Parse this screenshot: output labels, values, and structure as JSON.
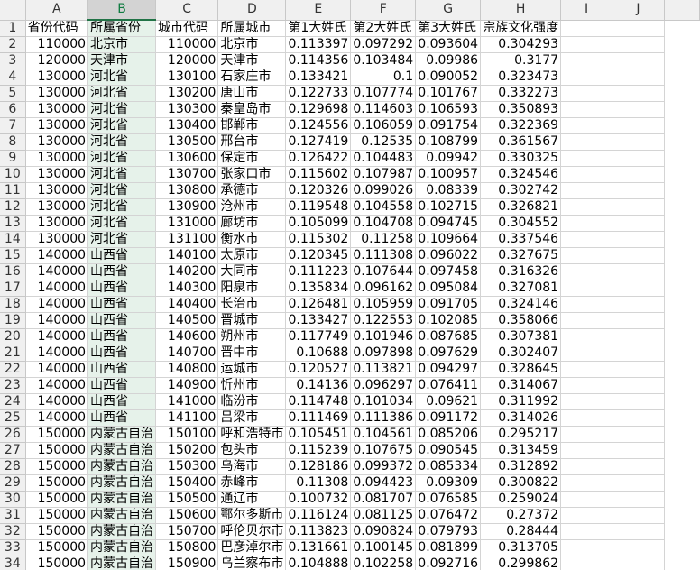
{
  "columns": [
    "A",
    "B",
    "C",
    "D",
    "E",
    "F",
    "G",
    "H",
    "I",
    "J"
  ],
  "selected_column": "B",
  "rows": [
    [
      "1",
      "省份代码",
      "所属省份",
      "城市代码",
      "所属城市",
      "第1大姓氏",
      "第2大姓氏",
      "第3大姓氏",
      "宗族文化强度",
      "",
      ""
    ],
    [
      "2",
      "110000",
      "北京市",
      "110000",
      "北京市",
      "0.113397",
      "0.097292",
      "0.093604",
      "0.304293",
      "",
      ""
    ],
    [
      "3",
      "120000",
      "天津市",
      "120000",
      "天津市",
      "0.114356",
      "0.103484",
      "0.09986",
      "0.3177",
      "",
      ""
    ],
    [
      "4",
      "130000",
      "河北省",
      "130100",
      "石家庄市",
      "0.133421",
      "0.1",
      "0.090052",
      "0.323473",
      "",
      ""
    ],
    [
      "5",
      "130000",
      "河北省",
      "130200",
      "唐山市",
      "0.122733",
      "0.107774",
      "0.101767",
      "0.332273",
      "",
      ""
    ],
    [
      "6",
      "130000",
      "河北省",
      "130300",
      "秦皇岛市",
      "0.129698",
      "0.114603",
      "0.106593",
      "0.350893",
      "",
      ""
    ],
    [
      "7",
      "130000",
      "河北省",
      "130400",
      "邯郸市",
      "0.124556",
      "0.106059",
      "0.091754",
      "0.322369",
      "",
      ""
    ],
    [
      "8",
      "130000",
      "河北省",
      "130500",
      "邢台市",
      "0.127419",
      "0.12535",
      "0.108799",
      "0.361567",
      "",
      ""
    ],
    [
      "9",
      "130000",
      "河北省",
      "130600",
      "保定市",
      "0.126422",
      "0.104483",
      "0.09942",
      "0.330325",
      "",
      ""
    ],
    [
      "10",
      "130000",
      "河北省",
      "130700",
      "张家口市",
      "0.115602",
      "0.107987",
      "0.100957",
      "0.324546",
      "",
      ""
    ],
    [
      "11",
      "130000",
      "河北省",
      "130800",
      "承德市",
      "0.120326",
      "0.099026",
      "0.08339",
      "0.302742",
      "",
      ""
    ],
    [
      "12",
      "130000",
      "河北省",
      "130900",
      "沧州市",
      "0.119548",
      "0.104558",
      "0.102715",
      "0.326821",
      "",
      ""
    ],
    [
      "13",
      "130000",
      "河北省",
      "131000",
      "廊坊市",
      "0.105099",
      "0.104708",
      "0.094745",
      "0.304552",
      "",
      ""
    ],
    [
      "14",
      "130000",
      "河北省",
      "131100",
      "衡水市",
      "0.115302",
      "0.11258",
      "0.109664",
      "0.337546",
      "",
      ""
    ],
    [
      "15",
      "140000",
      "山西省",
      "140100",
      "太原市",
      "0.120345",
      "0.111308",
      "0.096022",
      "0.327675",
      "",
      ""
    ],
    [
      "16",
      "140000",
      "山西省",
      "140200",
      "大同市",
      "0.111223",
      "0.107644",
      "0.097458",
      "0.316326",
      "",
      ""
    ],
    [
      "17",
      "140000",
      "山西省",
      "140300",
      "阳泉市",
      "0.135834",
      "0.096162",
      "0.095084",
      "0.327081",
      "",
      ""
    ],
    [
      "18",
      "140000",
      "山西省",
      "140400",
      "长治市",
      "0.126481",
      "0.105959",
      "0.091705",
      "0.324146",
      "",
      ""
    ],
    [
      "19",
      "140000",
      "山西省",
      "140500",
      "晋城市",
      "0.133427",
      "0.122553",
      "0.102085",
      "0.358066",
      "",
      ""
    ],
    [
      "20",
      "140000",
      "山西省",
      "140600",
      "朔州市",
      "0.117749",
      "0.101946",
      "0.087685",
      "0.307381",
      "",
      ""
    ],
    [
      "21",
      "140000",
      "山西省",
      "140700",
      "晋中市",
      "0.10688",
      "0.097898",
      "0.097629",
      "0.302407",
      "",
      ""
    ],
    [
      "22",
      "140000",
      "山西省",
      "140800",
      "运城市",
      "0.120527",
      "0.113821",
      "0.094297",
      "0.328645",
      "",
      ""
    ],
    [
      "23",
      "140000",
      "山西省",
      "140900",
      "忻州市",
      "0.14136",
      "0.096297",
      "0.076411",
      "0.314067",
      "",
      ""
    ],
    [
      "24",
      "140000",
      "山西省",
      "141000",
      "临汾市",
      "0.114748",
      "0.101034",
      "0.09621",
      "0.311992",
      "",
      ""
    ],
    [
      "25",
      "140000",
      "山西省",
      "141100",
      "吕梁市",
      "0.111469",
      "0.111386",
      "0.091172",
      "0.314026",
      "",
      ""
    ],
    [
      "26",
      "150000",
      "内蒙古自治",
      "150100",
      "呼和浩特市",
      "0.105451",
      "0.104561",
      "0.085206",
      "0.295217",
      "",
      ""
    ],
    [
      "27",
      "150000",
      "内蒙古自治",
      "150200",
      "包头市",
      "0.115239",
      "0.107675",
      "0.090545",
      "0.313459",
      "",
      ""
    ],
    [
      "28",
      "150000",
      "内蒙古自治",
      "150300",
      "乌海市",
      "0.128186",
      "0.099372",
      "0.085334",
      "0.312892",
      "",
      ""
    ],
    [
      "29",
      "150000",
      "内蒙古自治",
      "150400",
      "赤峰市",
      "0.11308",
      "0.094423",
      "0.09309",
      "0.300822",
      "",
      ""
    ],
    [
      "30",
      "150000",
      "内蒙古自治",
      "150500",
      "通辽市",
      "0.100732",
      "0.081707",
      "0.076585",
      "0.259024",
      "",
      ""
    ],
    [
      "31",
      "150000",
      "内蒙古自治",
      "150600",
      "鄂尔多斯市",
      "0.116124",
      "0.081125",
      "0.076472",
      "0.27372",
      "",
      ""
    ],
    [
      "32",
      "150000",
      "内蒙古自治",
      "150700",
      "呼伦贝尔市",
      "0.113823",
      "0.090824",
      "0.079793",
      "0.28444",
      "",
      ""
    ],
    [
      "33",
      "150000",
      "内蒙古自治",
      "150800",
      "巴彦淖尔市",
      "0.131661",
      "0.100145",
      "0.081899",
      "0.313705",
      "",
      ""
    ],
    [
      "34",
      "150000",
      "内蒙古自治",
      "150900",
      "乌兰察布市",
      "0.104888",
      "0.102258",
      "0.092716",
      "0.299862",
      "",
      ""
    ]
  ]
}
